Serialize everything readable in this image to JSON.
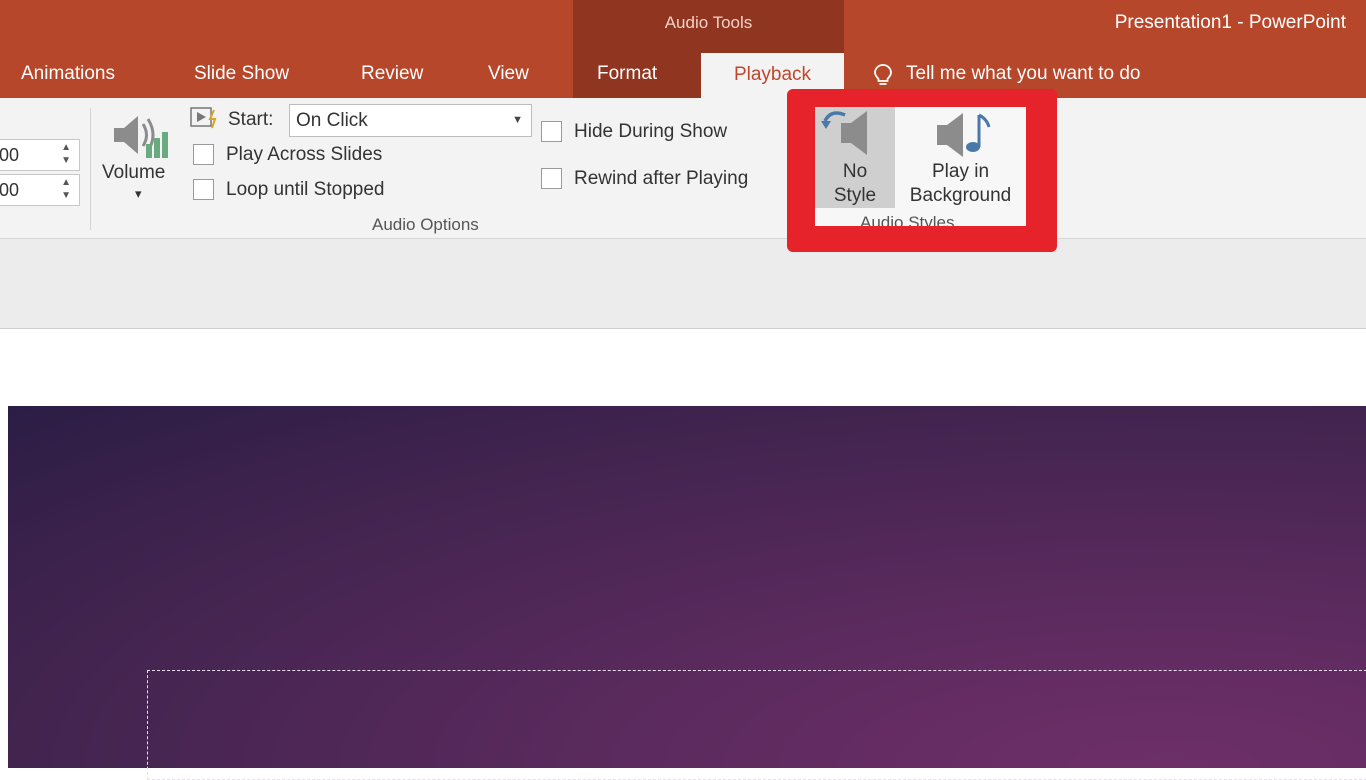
{
  "title_bar": {
    "contextual_group": "Audio Tools",
    "document_title": "Presentation1 - PowerPoint"
  },
  "tabs": [
    {
      "label": "Animations"
    },
    {
      "label": "Slide Show"
    },
    {
      "label": "Review"
    },
    {
      "label": "View"
    },
    {
      "label": "Format"
    },
    {
      "label": "Playback",
      "active": true
    }
  ],
  "tell_me": {
    "icon": "lightbulb-icon",
    "text": "Tell me what you want to do"
  },
  "ribbon": {
    "fade": {
      "fade_in_value": "00",
      "fade_out_value": "00"
    },
    "volume": {
      "icon": "speaker-volume-icon",
      "label": "Volume",
      "dropdown": "▾"
    },
    "audio_options": {
      "start_label": "Start:",
      "start_value": "On Click",
      "play_across_slides": {
        "label": "Play Across Slides",
        "checked": false
      },
      "loop_until_stopped": {
        "label": "Loop until Stopped",
        "checked": false
      },
      "hide_during_show": {
        "label": "Hide During Show",
        "checked": false
      },
      "rewind_after_playing": {
        "label": "Rewind after Playing",
        "checked": false
      },
      "group_label": "Audio Options"
    },
    "audio_styles": {
      "no_style": {
        "line1": "No",
        "line2": "Style",
        "icon": "no-style-speaker-icon"
      },
      "play_in_background": {
        "line1": "Play in",
        "line2": "Background",
        "icon": "speaker-music-note-icon"
      },
      "group_label": "Audio Styles"
    }
  },
  "colors": {
    "title_bar": "#b7472a",
    "contextual_band": "#8f3520",
    "highlight": "#e6222a",
    "slide_background": "#4a2556"
  }
}
